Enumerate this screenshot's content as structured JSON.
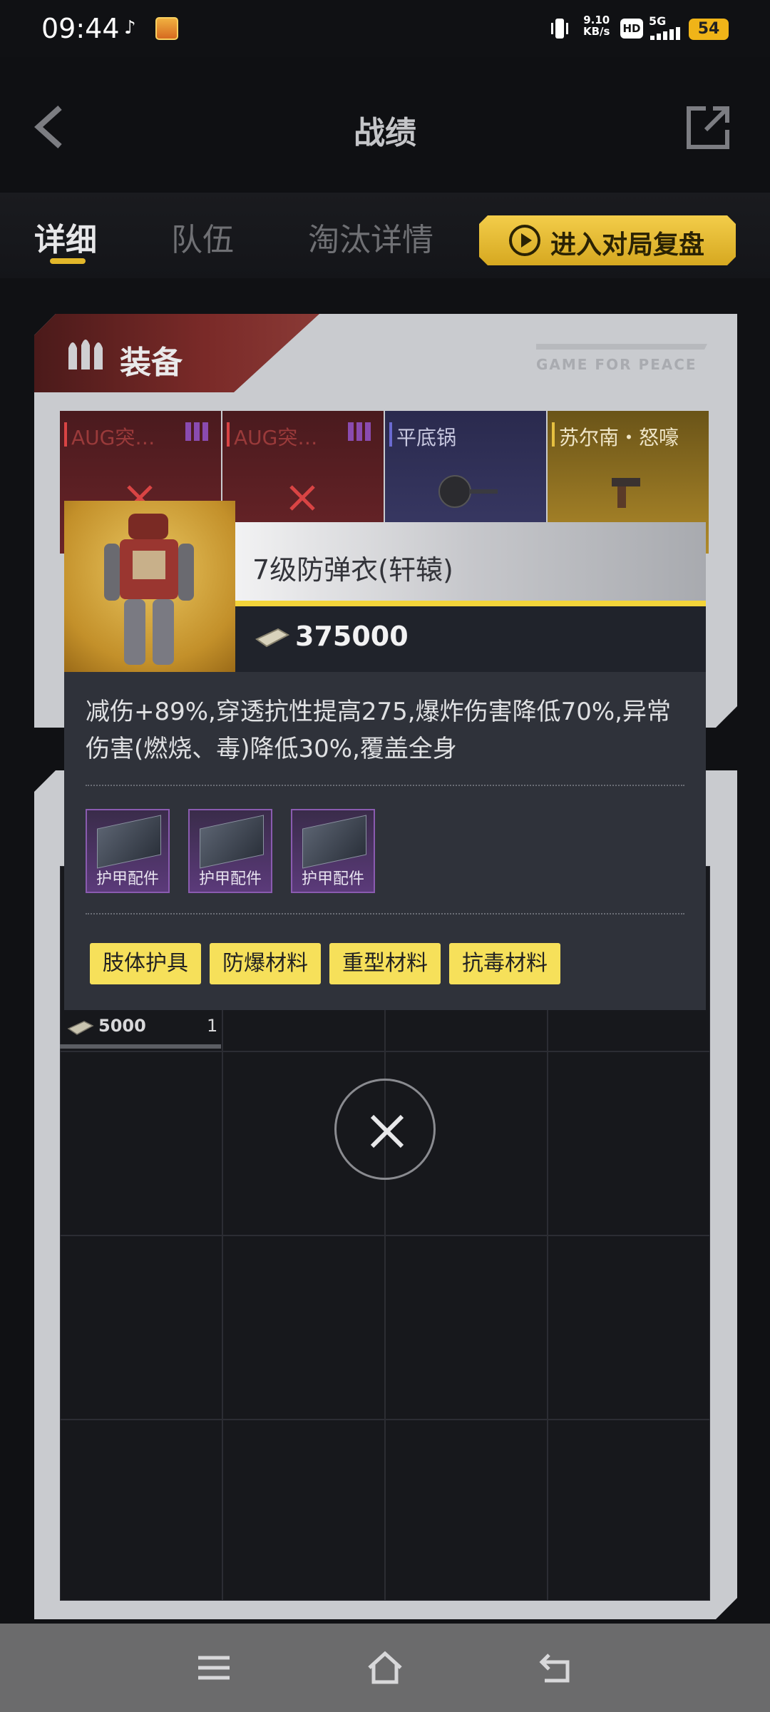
{
  "status_bar": {
    "time": "09:44",
    "speed_value": "9.10",
    "speed_unit": "KB/s",
    "hd": "HD",
    "network": "5G",
    "battery": "54"
  },
  "header": {
    "title": "战绩"
  },
  "tabs": [
    {
      "label": "详细"
    },
    {
      "label": "队伍"
    },
    {
      "label": "淘汰详情"
    }
  ],
  "replay_button": {
    "label": "进入对局复盘"
  },
  "equipment": {
    "title": "装备",
    "watermark": "GAME FOR PEACE",
    "weapons": [
      {
        "label": "AUG突…"
      },
      {
        "label": "AUG突…"
      },
      {
        "label": "平底锅"
      },
      {
        "label": "苏尔南・怒嚎"
      }
    ]
  },
  "backpack": {
    "item_value": "5000",
    "item_count": "1"
  },
  "popup": {
    "item_name": "7级防弹衣(轩辕)",
    "price": "375000",
    "description": "减伤+89%,穿透抗性提高275,爆炸伤害降低70%,异常伤害(燃烧、毒)降低30%,覆盖全身",
    "accessories": [
      {
        "label": "护甲配件"
      },
      {
        "label": "护甲配件"
      },
      {
        "label": "护甲配件"
      }
    ],
    "tags": [
      "肢体护具",
      "防爆材料",
      "重型材料",
      "抗毒材料"
    ]
  },
  "colors": {
    "accent_gold": "#e2b72a",
    "tag_yellow": "#f6e05a",
    "accessory_purple": "#8a5bb0",
    "danger_red": "#d94444"
  }
}
